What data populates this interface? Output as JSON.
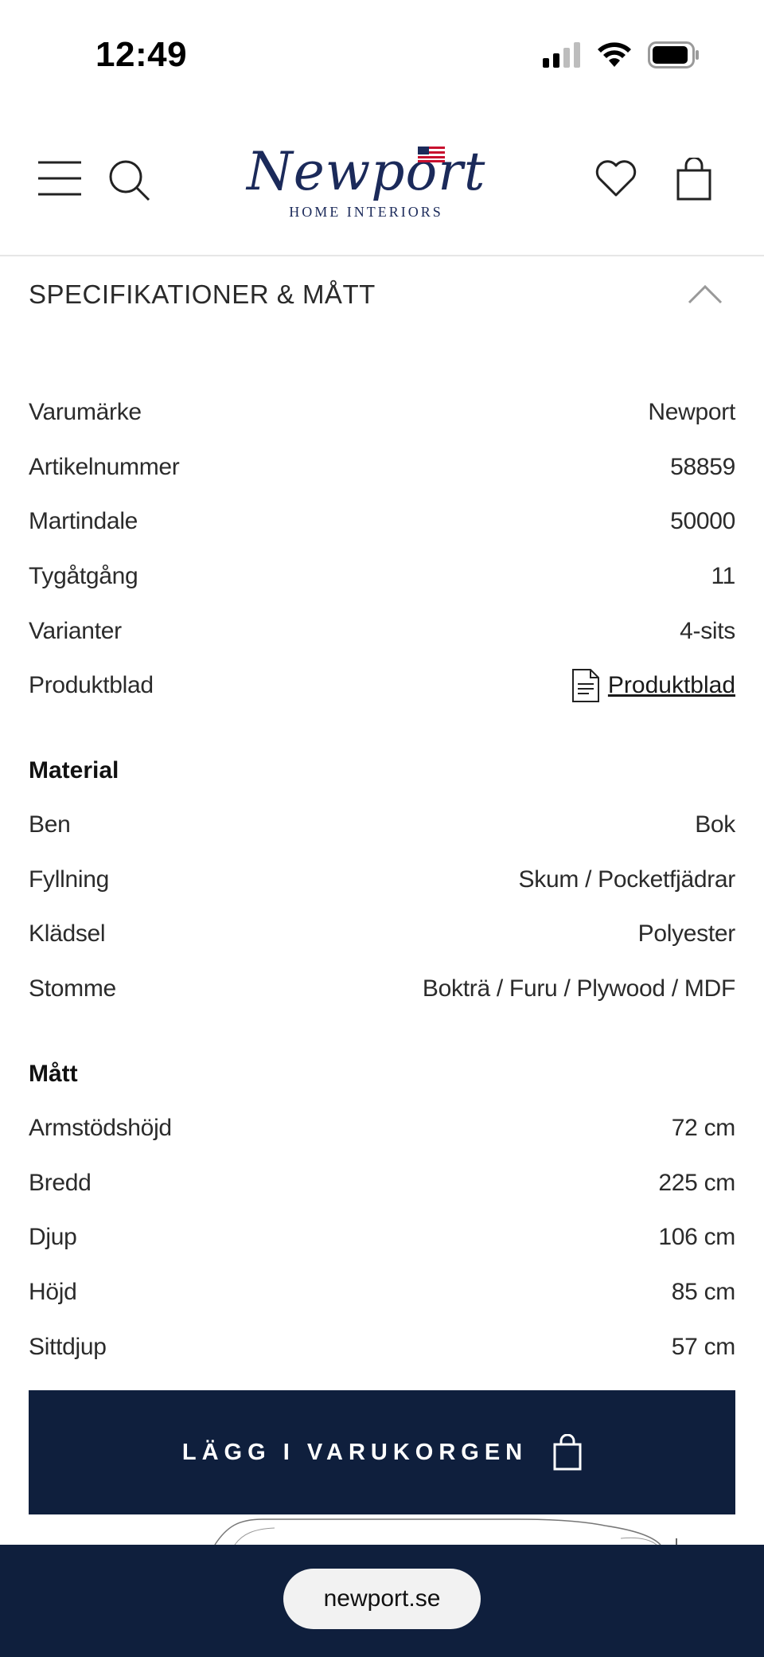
{
  "status_bar": {
    "time": "12:49"
  },
  "header": {
    "logo_script": "Newport",
    "logo_subtitle": "HOME INTERIORS"
  },
  "section": {
    "title": "SPECIFIKATIONER & MÅTT"
  },
  "specs": [
    {
      "label": "Varumärke",
      "value": "Newport"
    },
    {
      "label": "Artikelnummer",
      "value": "58859"
    },
    {
      "label": "Martindale",
      "value": "50000"
    },
    {
      "label": "Tygåtgång",
      "value": "11"
    },
    {
      "label": "Varianter",
      "value": "4-sits"
    },
    {
      "label": "Produktblad",
      "value": "Produktblad",
      "icon": "document-icon"
    }
  ],
  "material": {
    "title": "Material",
    "rows": [
      {
        "label": "Ben",
        "value": "Bok"
      },
      {
        "label": "Fyllning",
        "value": "Skum / Pocketfjädrar"
      },
      {
        "label": "Klädsel",
        "value": "Polyester"
      },
      {
        "label": "Stomme",
        "value": "Bokträ / Furu / Plywood / MDF"
      }
    ]
  },
  "dimensions": {
    "title": "Mått",
    "rows": [
      {
        "label": "Armstödshöjd",
        "value": "72 cm"
      },
      {
        "label": "Bredd",
        "value": "225 cm"
      },
      {
        "label": "Djup",
        "value": "106 cm"
      },
      {
        "label": "Höjd",
        "value": "85 cm"
      },
      {
        "label": "Sittdjup",
        "value": "57 cm"
      }
    ]
  },
  "cta": {
    "label": "LÄGG I VARUKORGEN"
  },
  "browser": {
    "url": "newport.se"
  },
  "colors": {
    "navy": "#0f1f3d",
    "logo_blue": "#1b2a5a"
  }
}
